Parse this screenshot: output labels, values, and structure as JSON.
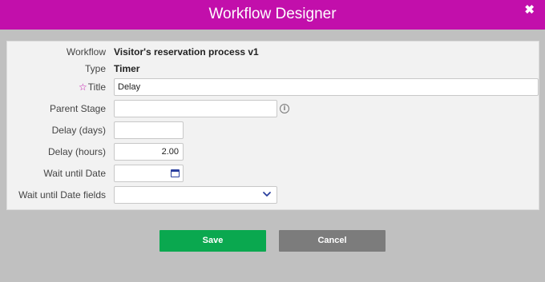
{
  "dialog": {
    "title": "Workflow Designer",
    "close_glyph": "✖"
  },
  "form": {
    "workflow": {
      "label": "Workflow",
      "value": "Visitor's reservation process v1"
    },
    "type": {
      "label": "Type",
      "value": "Timer"
    },
    "title": {
      "label": "Title",
      "required_marker": "☆",
      "value": "Delay"
    },
    "parent_stage": {
      "label": "Parent Stage",
      "value": "",
      "info_glyph": "i"
    },
    "delay_days": {
      "label": "Delay (days)",
      "value": ""
    },
    "delay_hours": {
      "label": "Delay (hours)",
      "value": "2.00"
    },
    "wait_until_date": {
      "label": "Wait until Date",
      "value": "",
      "icon": "calendar-icon"
    },
    "wait_until_date_fields": {
      "label": "Wait until Date fields",
      "value": "",
      "icon": "chevron-down-icon"
    }
  },
  "buttons": {
    "save": "Save",
    "cancel": "Cancel"
  },
  "colors": {
    "titlebar": "#c20fab",
    "save": "#0aa84f",
    "cancel": "#7c7c7c",
    "accent_icon": "#2a3f9e"
  }
}
